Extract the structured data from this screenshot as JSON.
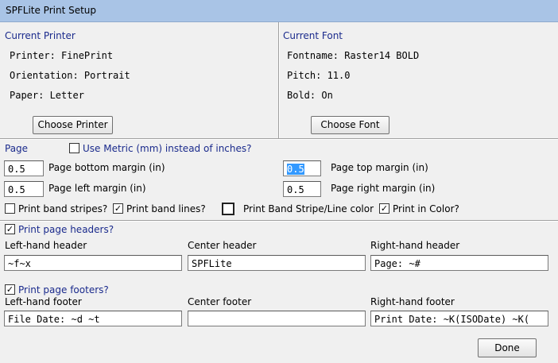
{
  "window": {
    "title": "SPFLite Print Setup"
  },
  "printer": {
    "heading": "Current Printer",
    "printer": "Printer: FinePrint",
    "orientation": "Orientation: Portrait",
    "paper": "Paper: Letter",
    "button": "Choose Printer"
  },
  "font": {
    "heading": "Current Font",
    "fontname": "Fontname: Raster14 BOLD",
    "pitch": "Pitch: 11.0",
    "bold": "Bold: On",
    "button": "Choose Font"
  },
  "page": {
    "heading": "Page",
    "metric_label": "Use Metric (mm) instead of inches?",
    "metric_checked": false,
    "bottom_margin_value": "0.5",
    "bottom_margin_label": "Page bottom margin (in)",
    "top_margin_value": "0.5",
    "top_margin_label": "Page top margin (in)",
    "left_margin_value": "0.5",
    "left_margin_label": "Page left margin (in)",
    "right_margin_value": "0.5",
    "right_margin_label": "Page right margin (in)"
  },
  "options": {
    "band_stripes_label": "Print band stripes?",
    "band_stripes_checked": false,
    "band_lines_label": "Print band lines?",
    "band_lines_checked": true,
    "stripe_color_label": "Print Band Stripe/Line color",
    "stripe_color": "#ffffff",
    "color_label": "Print in Color?",
    "color_checked": true
  },
  "headers": {
    "print_label": "Print page headers?",
    "print_checked": true,
    "left_label": "Left-hand header",
    "left_value": "~f~x",
    "center_label": "Center header",
    "center_value": "SPFLite",
    "right_label": "Right-hand header",
    "right_value": "Page: ~#"
  },
  "footers": {
    "print_label": "Print page footers?",
    "print_checked": true,
    "left_label": "Left-hand footer",
    "left_value": "File Date: ~d ~t",
    "center_label": "Center footer",
    "center_value": "",
    "right_label": "Right-hand footer",
    "right_value": "Print Date: ~K(ISODate) ~K("
  },
  "done_button": "Done",
  "check_mark": "✓"
}
